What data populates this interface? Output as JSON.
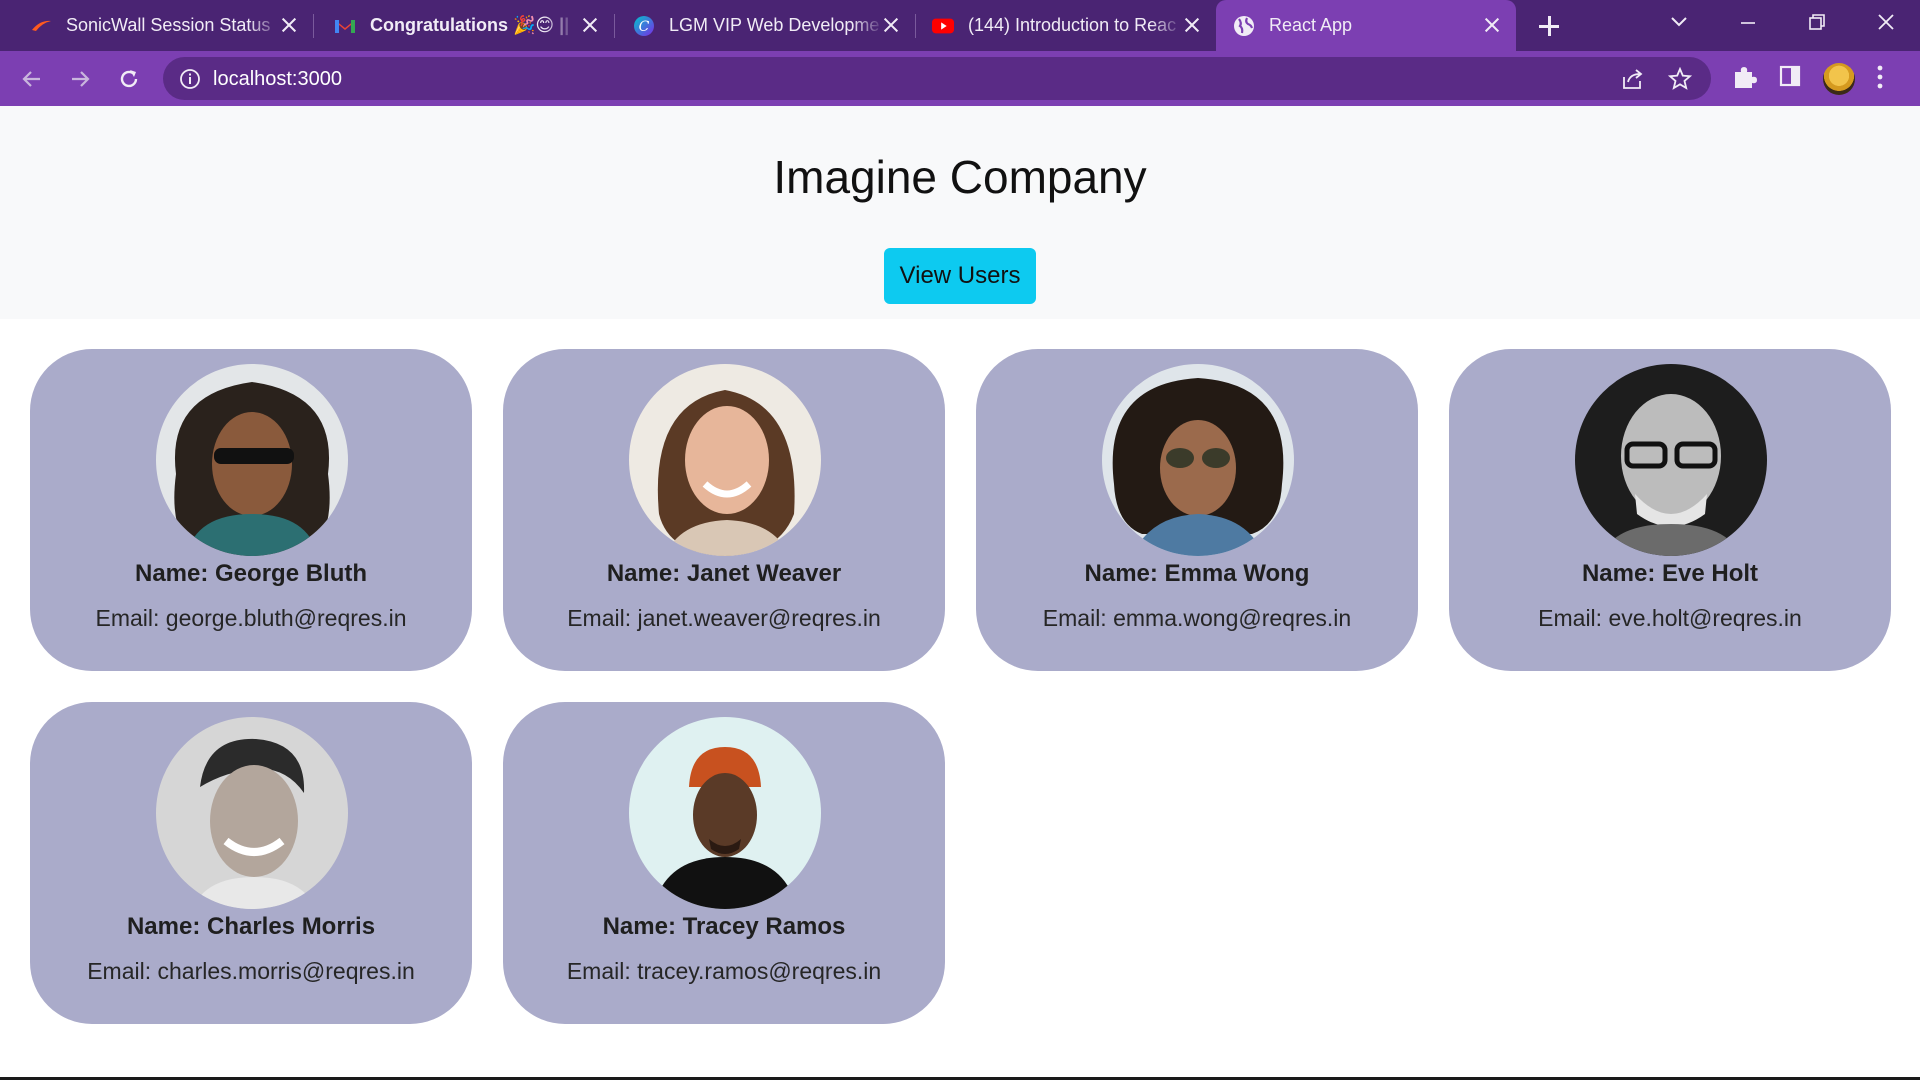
{
  "browser": {
    "tabs": [
      {
        "title": "SonicWall Session Status",
        "icon": "sonicwall-icon",
        "bold": false
      },
      {
        "title": "Congratulations 🎉😊 || G",
        "icon": "gmail-icon",
        "bold": true
      },
      {
        "title": "LGM VIP Web Developme",
        "icon": "canva-icon",
        "bold": false
      },
      {
        "title": "(144) Introduction to Reac",
        "icon": "youtube-icon",
        "bold": false
      },
      {
        "title": "React App",
        "icon": "globe-icon",
        "bold": false
      }
    ],
    "url": "localhost:3000"
  },
  "page": {
    "title": "Imagine Company",
    "button_label": "View Users"
  },
  "users": [
    {
      "name": "Name: George Bluth",
      "email": "Email: george.bluth@reqres.in"
    },
    {
      "name": "Name: Janet Weaver",
      "email": "Email: janet.weaver@reqres.in"
    },
    {
      "name": "Name: Emma Wong",
      "email": "Email: emma.wong@reqres.in"
    },
    {
      "name": "Name: Eve Holt",
      "email": "Email: eve.holt@reqres.in"
    },
    {
      "name": "Name: Charles Morris",
      "email": "Email: charles.morris@reqres.in"
    },
    {
      "name": "Name: Tracey Ramos",
      "email": "Email: tracey.ramos@reqres.in"
    }
  ],
  "colors": {
    "tabstrip": "#4a2473",
    "toolbar": "#7c3fb2",
    "card": "#aaabca",
    "button": "#0dcaf0"
  }
}
